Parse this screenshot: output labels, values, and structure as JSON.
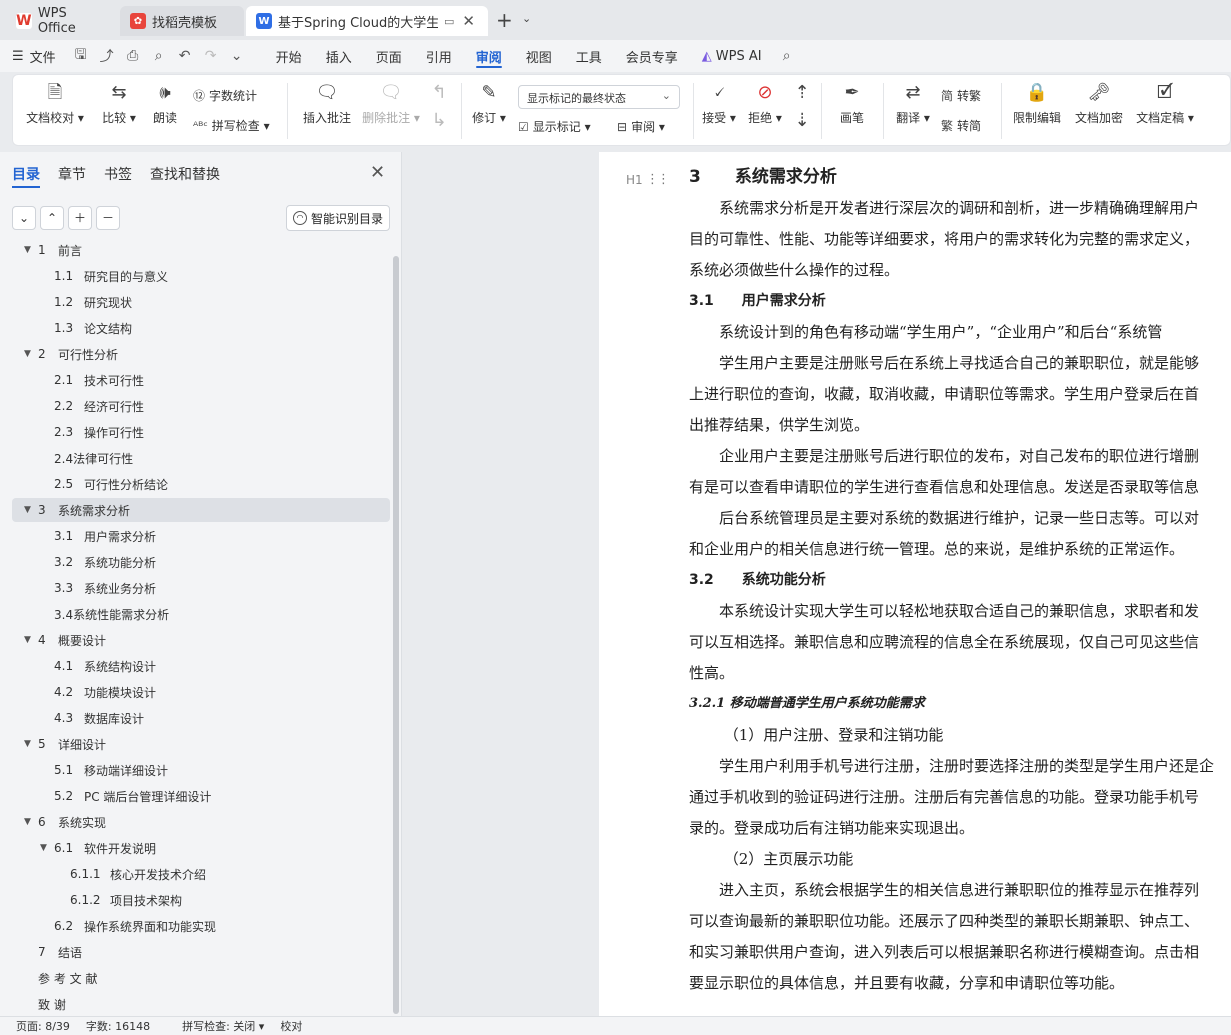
{
  "tabs": {
    "wps": "WPS Office",
    "templates": "找稻壳模板",
    "doc": "基于Spring Cloud的大学生兼职平台",
    "new": "+",
    "menu": "⌄"
  },
  "menubar": {
    "file": "文件",
    "items": [
      "开始",
      "插入",
      "页面",
      "引用",
      "审阅",
      "视图",
      "工具",
      "会员专享"
    ],
    "ai": "WPS AI"
  },
  "ribbon": {
    "proofread": "文档校对",
    "compare": "比较",
    "read_aloud": "朗读",
    "word_count": "字数统计",
    "spell_check": "拼写检查",
    "insert_comment": "插入批注",
    "delete_comment": "删除批注",
    "track": "修订",
    "markup_state": "显示标记的最终状态",
    "show_markup": "显示标记",
    "review": "审阅",
    "accept": "接受",
    "reject": "拒绝",
    "pen": "画笔",
    "translate": "翻译",
    "to_traditional": "转繁",
    "to_simplified": "转简",
    "restrict_edit": "限制编辑",
    "encrypt": "文档加密",
    "finalize": "文档定稿"
  },
  "nav": {
    "tabs": [
      "目录",
      "章节",
      "书签",
      "查找和替换"
    ],
    "smart_toc": "智能识别目录",
    "toc": [
      {
        "num": "1",
        "text": "前言",
        "level": 1,
        "arrow": "▼"
      },
      {
        "num": "1.1",
        "text": "研究目的与意义",
        "level": 2
      },
      {
        "num": "1.2",
        "text": "研究现状",
        "level": 2
      },
      {
        "num": "1.3",
        "text": "论文结构",
        "level": 2
      },
      {
        "num": "2",
        "text": "可行性分析",
        "level": 1,
        "arrow": "▼"
      },
      {
        "num": "2.1",
        "text": "技术可行性",
        "level": 2
      },
      {
        "num": "2.2",
        "text": "经济可行性",
        "level": 2
      },
      {
        "num": "2.3",
        "text": "操作可行性",
        "level": 2
      },
      {
        "num": "",
        "text": "2.4法律可行性",
        "level": 2
      },
      {
        "num": "2.5",
        "text": "可行性分析结论",
        "level": 2
      },
      {
        "num": "3",
        "text": "系统需求分析",
        "level": 1,
        "arrow": "▼",
        "selected": true
      },
      {
        "num": "3.1",
        "text": "用户需求分析",
        "level": 2
      },
      {
        "num": "3.2",
        "text": "系统功能分析",
        "level": 2
      },
      {
        "num": "3.3",
        "text": "系统业务分析",
        "level": 2
      },
      {
        "num": "",
        "text": "3.4系统性能需求分析",
        "level": 2
      },
      {
        "num": "4",
        "text": "概要设计",
        "level": 1,
        "arrow": "▼"
      },
      {
        "num": "4.1",
        "text": "系统结构设计",
        "level": 2
      },
      {
        "num": "4.2",
        "text": "功能模块设计",
        "level": 2
      },
      {
        "num": "4.3",
        "text": "数据库设计",
        "level": 2
      },
      {
        "num": "5",
        "text": "详细设计",
        "level": 1,
        "arrow": "▼"
      },
      {
        "num": "5.1",
        "text": "移动端详细设计",
        "level": 2
      },
      {
        "num": "5.2",
        "text": "PC 端后台管理详细设计",
        "level": 2
      },
      {
        "num": "6",
        "text": "系统实现",
        "level": 1,
        "arrow": "▼"
      },
      {
        "num": "6.1",
        "text": "软件开发说明",
        "level": 2,
        "arrow": "▼"
      },
      {
        "num": "6.1.1",
        "text": "核心开发技术介绍",
        "level": 3
      },
      {
        "num": "6.1.2",
        "text": "项目技术架构",
        "level": 3
      },
      {
        "num": "6.2",
        "text": "操作系统界面和功能实现",
        "level": 2
      },
      {
        "num": "7",
        "text": "结语",
        "level": 1
      },
      {
        "num": "",
        "text": "参  考  文  献",
        "level": 1
      },
      {
        "num": "",
        "text": "致        谢",
        "level": 1
      }
    ]
  },
  "document": {
    "heading_mark": "H1",
    "lines": [
      {
        "t": "3    系统需求分析",
        "s": "h1"
      },
      {
        "t": "    系统需求分析是开发者进行深层次的调研和剖析，进一步精确确理解用户",
        "s": ""
      },
      {
        "t": "目的可靠性、性能、功能等详细要求，将用户的需求转化为完整的需求定义，",
        "s": ""
      },
      {
        "t": "系统必须做些什么操作的过程。",
        "s": ""
      },
      {
        "t": "3.1    用户需求分析",
        "s": "h2"
      },
      {
        "t": "    系统设计到的角色有移动端“学生用户”，“企业用户”和后台“系统管",
        "s": ""
      },
      {
        "t": "    学生用户主要是注册账号后在系统上寻找适合自己的兼职职位，就是能够",
        "s": ""
      },
      {
        "t": "上进行职位的查询，收藏，取消收藏，申请职位等需求。学生用户登录后在首",
        "s": ""
      },
      {
        "t": "出推荐结果，供学生浏览。",
        "s": ""
      },
      {
        "t": "    企业用户主要是注册账号后进行职位的发布，对自己发布的职位进行增删",
        "s": ""
      },
      {
        "t": "有是可以查看申请职位的学生进行查看信息和处理信息。发送是否录取等信息",
        "s": ""
      },
      {
        "t": "    后台系统管理员是主要对系统的数据进行维护，记录一些日志等。可以对",
        "s": ""
      },
      {
        "t": "和企业用户的相关信息进行统一管理。总的来说，是维护系统的正常运作。",
        "s": ""
      },
      {
        "t": "3.2    系统功能分析",
        "s": "h2"
      },
      {
        "t": "    本系统设计实现大学生可以轻松地获取合适自己的兼职信息，求职者和发",
        "s": ""
      },
      {
        "t": "可以互相选择。兼职信息和应聘流程的信息全在系统展现，仅自己可见这些信",
        "s": ""
      },
      {
        "t": "性高。",
        "s": ""
      },
      {
        "t": "3.2.1 移动端普通学生用户系统功能需求",
        "s": "h3"
      },
      {
        "t": "     （1）用户注册、登录和注销功能",
        "s": ""
      },
      {
        "t": "    学生用户利用手机号进行注册，注册时要选择注册的类型是学生用户还是企",
        "s": ""
      },
      {
        "t": "通过手机收到的验证码进行注册。注册后有完善信息的功能。登录功能手机号",
        "s": ""
      },
      {
        "t": "录的。登录成功后有注销功能来实现退出。",
        "s": ""
      },
      {
        "t": "     （2）主页展示功能",
        "s": ""
      },
      {
        "t": "    进入主页，系统会根据学生的相关信息进行兼职职位的推荐显示在推荐列",
        "s": ""
      },
      {
        "t": "可以查询最新的兼职职位功能。还展示了四种类型的兼职长期兼职、钟点工、",
        "s": ""
      },
      {
        "t": "和实习兼职供用户查询，进入列表后可以根据兼职名称进行模糊查询。点击相",
        "s": ""
      },
      {
        "t": "要显示职位的具体信息，并且要有收藏，分享和申请职位等功能。",
        "s": ""
      }
    ]
  },
  "status": {
    "page": "页面: 8/39",
    "words": "字数: 16148",
    "spell": "拼写检查: 关闭",
    "proof": "校对"
  }
}
